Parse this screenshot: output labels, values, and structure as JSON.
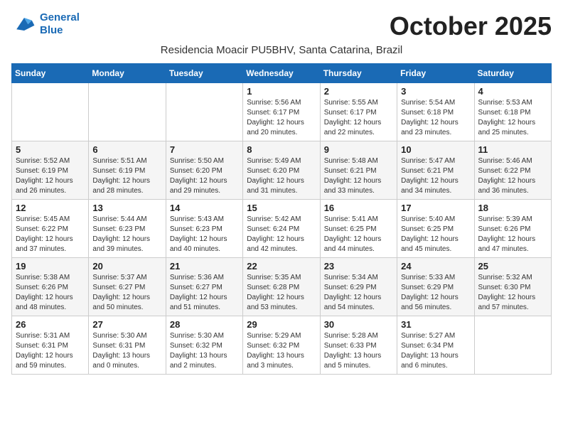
{
  "header": {
    "logo_line1": "General",
    "logo_line2": "Blue",
    "month_title": "October 2025",
    "subtitle": "Residencia Moacir PU5BHV, Santa Catarina, Brazil"
  },
  "weekdays": [
    "Sunday",
    "Monday",
    "Tuesday",
    "Wednesday",
    "Thursday",
    "Friday",
    "Saturday"
  ],
  "weeks": [
    [
      {
        "day": "",
        "info": ""
      },
      {
        "day": "",
        "info": ""
      },
      {
        "day": "",
        "info": ""
      },
      {
        "day": "1",
        "info": "Sunrise: 5:56 AM\nSunset: 6:17 PM\nDaylight: 12 hours\nand 20 minutes."
      },
      {
        "day": "2",
        "info": "Sunrise: 5:55 AM\nSunset: 6:17 PM\nDaylight: 12 hours\nand 22 minutes."
      },
      {
        "day": "3",
        "info": "Sunrise: 5:54 AM\nSunset: 6:18 PM\nDaylight: 12 hours\nand 23 minutes."
      },
      {
        "day": "4",
        "info": "Sunrise: 5:53 AM\nSunset: 6:18 PM\nDaylight: 12 hours\nand 25 minutes."
      }
    ],
    [
      {
        "day": "5",
        "info": "Sunrise: 5:52 AM\nSunset: 6:19 PM\nDaylight: 12 hours\nand 26 minutes."
      },
      {
        "day": "6",
        "info": "Sunrise: 5:51 AM\nSunset: 6:19 PM\nDaylight: 12 hours\nand 28 minutes."
      },
      {
        "day": "7",
        "info": "Sunrise: 5:50 AM\nSunset: 6:20 PM\nDaylight: 12 hours\nand 29 minutes."
      },
      {
        "day": "8",
        "info": "Sunrise: 5:49 AM\nSunset: 6:20 PM\nDaylight: 12 hours\nand 31 minutes."
      },
      {
        "day": "9",
        "info": "Sunrise: 5:48 AM\nSunset: 6:21 PM\nDaylight: 12 hours\nand 33 minutes."
      },
      {
        "day": "10",
        "info": "Sunrise: 5:47 AM\nSunset: 6:21 PM\nDaylight: 12 hours\nand 34 minutes."
      },
      {
        "day": "11",
        "info": "Sunrise: 5:46 AM\nSunset: 6:22 PM\nDaylight: 12 hours\nand 36 minutes."
      }
    ],
    [
      {
        "day": "12",
        "info": "Sunrise: 5:45 AM\nSunset: 6:22 PM\nDaylight: 12 hours\nand 37 minutes."
      },
      {
        "day": "13",
        "info": "Sunrise: 5:44 AM\nSunset: 6:23 PM\nDaylight: 12 hours\nand 39 minutes."
      },
      {
        "day": "14",
        "info": "Sunrise: 5:43 AM\nSunset: 6:23 PM\nDaylight: 12 hours\nand 40 minutes."
      },
      {
        "day": "15",
        "info": "Sunrise: 5:42 AM\nSunset: 6:24 PM\nDaylight: 12 hours\nand 42 minutes."
      },
      {
        "day": "16",
        "info": "Sunrise: 5:41 AM\nSunset: 6:25 PM\nDaylight: 12 hours\nand 44 minutes."
      },
      {
        "day": "17",
        "info": "Sunrise: 5:40 AM\nSunset: 6:25 PM\nDaylight: 12 hours\nand 45 minutes."
      },
      {
        "day": "18",
        "info": "Sunrise: 5:39 AM\nSunset: 6:26 PM\nDaylight: 12 hours\nand 47 minutes."
      }
    ],
    [
      {
        "day": "19",
        "info": "Sunrise: 5:38 AM\nSunset: 6:26 PM\nDaylight: 12 hours\nand 48 minutes."
      },
      {
        "day": "20",
        "info": "Sunrise: 5:37 AM\nSunset: 6:27 PM\nDaylight: 12 hours\nand 50 minutes."
      },
      {
        "day": "21",
        "info": "Sunrise: 5:36 AM\nSunset: 6:27 PM\nDaylight: 12 hours\nand 51 minutes."
      },
      {
        "day": "22",
        "info": "Sunrise: 5:35 AM\nSunset: 6:28 PM\nDaylight: 12 hours\nand 53 minutes."
      },
      {
        "day": "23",
        "info": "Sunrise: 5:34 AM\nSunset: 6:29 PM\nDaylight: 12 hours\nand 54 minutes."
      },
      {
        "day": "24",
        "info": "Sunrise: 5:33 AM\nSunset: 6:29 PM\nDaylight: 12 hours\nand 56 minutes."
      },
      {
        "day": "25",
        "info": "Sunrise: 5:32 AM\nSunset: 6:30 PM\nDaylight: 12 hours\nand 57 minutes."
      }
    ],
    [
      {
        "day": "26",
        "info": "Sunrise: 5:31 AM\nSunset: 6:31 PM\nDaylight: 12 hours\nand 59 minutes."
      },
      {
        "day": "27",
        "info": "Sunrise: 5:30 AM\nSunset: 6:31 PM\nDaylight: 13 hours\nand 0 minutes."
      },
      {
        "day": "28",
        "info": "Sunrise: 5:30 AM\nSunset: 6:32 PM\nDaylight: 13 hours\nand 2 minutes."
      },
      {
        "day": "29",
        "info": "Sunrise: 5:29 AM\nSunset: 6:32 PM\nDaylight: 13 hours\nand 3 minutes."
      },
      {
        "day": "30",
        "info": "Sunrise: 5:28 AM\nSunset: 6:33 PM\nDaylight: 13 hours\nand 5 minutes."
      },
      {
        "day": "31",
        "info": "Sunrise: 5:27 AM\nSunset: 6:34 PM\nDaylight: 13 hours\nand 6 minutes."
      },
      {
        "day": "",
        "info": ""
      }
    ]
  ]
}
